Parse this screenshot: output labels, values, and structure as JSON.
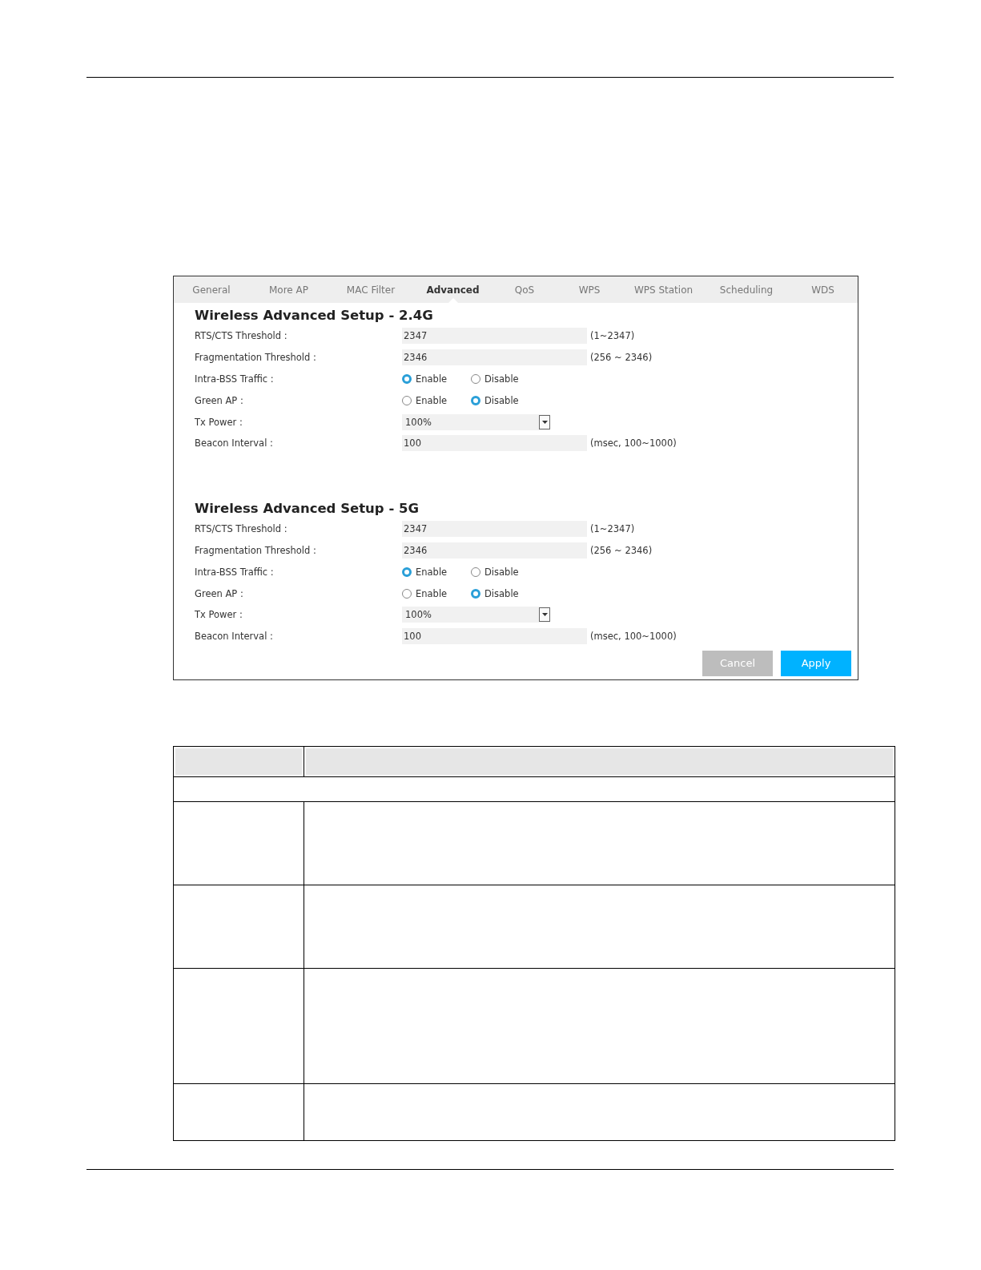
{
  "tabs": [
    {
      "label": "General",
      "selected": false
    },
    {
      "label": "More AP",
      "selected": false
    },
    {
      "label": "MAC Filter",
      "selected": false
    },
    {
      "label": "Advanced",
      "selected": true
    },
    {
      "label": "QoS",
      "selected": false
    },
    {
      "label": "WPS",
      "selected": false
    },
    {
      "label": "WPS Station",
      "selected": false
    },
    {
      "label": "Scheduling",
      "selected": false
    },
    {
      "label": "WDS",
      "selected": false
    }
  ],
  "sections": [
    {
      "title": "Wireless Advanced Setup - 2.4G",
      "rows": [
        {
          "kind": "text",
          "label": "RTS/CTS Threshold :",
          "value": "2347",
          "hint": "(1~2347)"
        },
        {
          "kind": "text",
          "label": "Fragmentation Threshold :",
          "value": "2346",
          "hint": "(256 ~ 2346)"
        },
        {
          "kind": "radio",
          "label": "Intra-BSS Traffic :",
          "options": [
            {
              "label": "Enable",
              "selected": true
            },
            {
              "label": "Disable",
              "selected": false
            }
          ]
        },
        {
          "kind": "radio",
          "label": "Green AP :",
          "options": [
            {
              "label": "Enable",
              "selected": false
            },
            {
              "label": "Disable",
              "selected": true
            }
          ]
        },
        {
          "kind": "select",
          "label": "Tx Power :",
          "value": "100%"
        },
        {
          "kind": "text",
          "label": "Beacon Interval :",
          "value": "100",
          "hint": "(msec, 100~1000)"
        }
      ]
    },
    {
      "title": "Wireless Advanced Setup - 5G",
      "rows": [
        {
          "kind": "text",
          "label": "RTS/CTS Threshold :",
          "value": "2347",
          "hint": "(1~2347)"
        },
        {
          "kind": "text",
          "label": "Fragmentation Threshold :",
          "value": "2346",
          "hint": "(256 ~ 2346)"
        },
        {
          "kind": "radio",
          "label": "Intra-BSS Traffic :",
          "options": [
            {
              "label": "Enable",
              "selected": true
            },
            {
              "label": "Disable",
              "selected": false
            }
          ]
        },
        {
          "kind": "radio",
          "label": "Green AP :",
          "options": [
            {
              "label": "Enable",
              "selected": false
            },
            {
              "label": "Disable",
              "selected": true
            }
          ]
        },
        {
          "kind": "select",
          "label": "Tx Power :",
          "value": "100%"
        },
        {
          "kind": "text",
          "label": "Beacon Interval :",
          "value": "100",
          "hint": "(msec, 100~1000)"
        }
      ]
    }
  ],
  "buttons": [
    {
      "label": "Cancel",
      "kind": "secondary"
    },
    {
      "label": "Apply",
      "kind": "primary"
    }
  ]
}
